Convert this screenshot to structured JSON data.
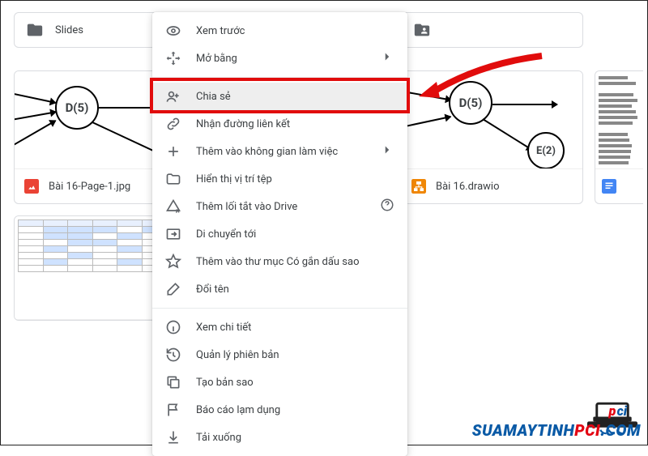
{
  "folders": [
    {
      "label": "Slides",
      "icon": "folder"
    },
    {
      "label": "",
      "icon": "folder-shared"
    }
  ],
  "files": [
    {
      "label": "Bài 16-Page-1.jpg",
      "icon": "image",
      "thumb": "diagram",
      "node1": "D(5)"
    },
    {
      "label": "Bài 16.drawio",
      "icon": "drawio",
      "thumb": "diagram2",
      "node1": "D(5)",
      "node2": "E(2)"
    },
    {
      "label": "",
      "icon": "doc",
      "thumb": "doc"
    }
  ],
  "files2": [
    {
      "label": "",
      "icon": "sheet",
      "thumb": "sheet"
    }
  ],
  "context_menu": {
    "items": [
      {
        "icon": "preview",
        "label": "Xem trước",
        "submenu": false
      },
      {
        "icon": "open-with",
        "label": "Mở bằng",
        "submenu": true
      },
      {
        "sep": true
      },
      {
        "icon": "share",
        "label": "Chia sẻ",
        "highlight": true
      },
      {
        "icon": "link",
        "label": "Nhận đường liên kết"
      },
      {
        "icon": "workspace",
        "label": "Thêm vào không gian làm việc",
        "submenu": true
      },
      {
        "icon": "location",
        "label": "Hiển thị vị trí tệp"
      },
      {
        "icon": "shortcut",
        "label": "Thêm lối tắt vào Drive",
        "help": true
      },
      {
        "icon": "move",
        "label": "Di chuyển tới"
      },
      {
        "icon": "star",
        "label": "Thêm vào thư mục Có gắn dấu sao"
      },
      {
        "icon": "rename",
        "label": "Đổi tên"
      },
      {
        "sep": true
      },
      {
        "icon": "details",
        "label": "Xem chi tiết"
      },
      {
        "icon": "versions",
        "label": "Quản lý phiên bản"
      },
      {
        "icon": "copy",
        "label": "Tạo bản sao"
      },
      {
        "icon": "flag",
        "label": "Báo cáo lạm dụng"
      },
      {
        "icon": "download",
        "label": "Tải xuống"
      }
    ]
  },
  "watermark": {
    "t1": "SUAMAYTINH",
    "t2": "PCI",
    "t3": ".COM"
  }
}
